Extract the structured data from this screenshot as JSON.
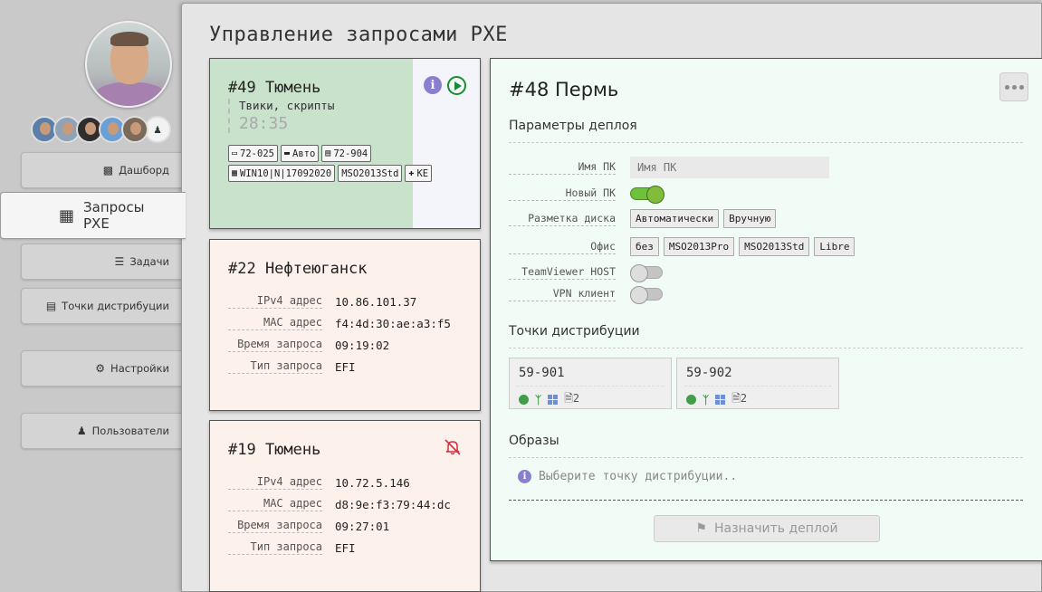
{
  "sidebar": {
    "nav": [
      {
        "label": "Дашборд",
        "icon": "chart-bar-icon"
      },
      {
        "label": "Запросы PXE",
        "icon": "chip-icon"
      },
      {
        "label": "Задачи",
        "icon": "tasks-icon"
      },
      {
        "label": "Точки дистрибуции",
        "icon": "server-icon"
      },
      {
        "label": "Настройки",
        "icon": "gears-icon"
      },
      {
        "label": "Пользователи",
        "icon": "users-icon"
      }
    ]
  },
  "page": {
    "title": "Управление запросами PXE"
  },
  "requests": [
    {
      "title": "#49 Тюмень",
      "subtitle": "Твики, скрипты",
      "time": "28:35",
      "tags": [
        "72-025",
        "Авто",
        "72-904",
        "WIN10|N|17092020",
        "MSO2013Std",
        "KE"
      ]
    },
    {
      "title": "#22 Нефтеюганск",
      "fields": [
        {
          "k": "IPv4 адрес",
          "v": "10.86.101.37"
        },
        {
          "k": "MAC адрес",
          "v": "f4:4d:30:ae:a3:f5"
        },
        {
          "k": "Время запроса",
          "v": "09:19:02"
        },
        {
          "k": "Тип запроса",
          "v": "EFI"
        }
      ]
    },
    {
      "title": "#19 Тюмень",
      "fields": [
        {
          "k": "IPv4 адрес",
          "v": "10.72.5.146"
        },
        {
          "k": "MAC адрес",
          "v": "d8:9e:f3:79:44:dc"
        },
        {
          "k": "Время запроса",
          "v": "09:27:01"
        },
        {
          "k": "Тип запроса",
          "v": "EFI"
        }
      ]
    }
  ],
  "detail": {
    "title": "#48 Пермь",
    "deploy_params": "Параметры деплоя",
    "pc_name_label": "Имя ПК",
    "pc_name_placeholder": "Имя ПК",
    "new_pc_label": "Новый ПК",
    "new_pc": true,
    "disk_label": "Разметка диска",
    "disk_opts": [
      "Автоматически",
      "Вручную"
    ],
    "office_label": "Офис",
    "office_opts": [
      "без",
      "MSO2013Pro",
      "MSO2013Std",
      "Libre"
    ],
    "teamviewer_label": "TeamViewer HOST",
    "teamviewer": false,
    "vpn_label": "VPN клиент",
    "vpn": false,
    "dist_points_h": "Точки дистрибуции",
    "dist_points": [
      {
        "name": "59-901",
        "count": "2"
      },
      {
        "name": "59-902",
        "count": "2"
      }
    ],
    "images_h": "Образы",
    "images_hint": "Выберите точку дистрибуции..",
    "assign_label": "Назначить деплой"
  }
}
